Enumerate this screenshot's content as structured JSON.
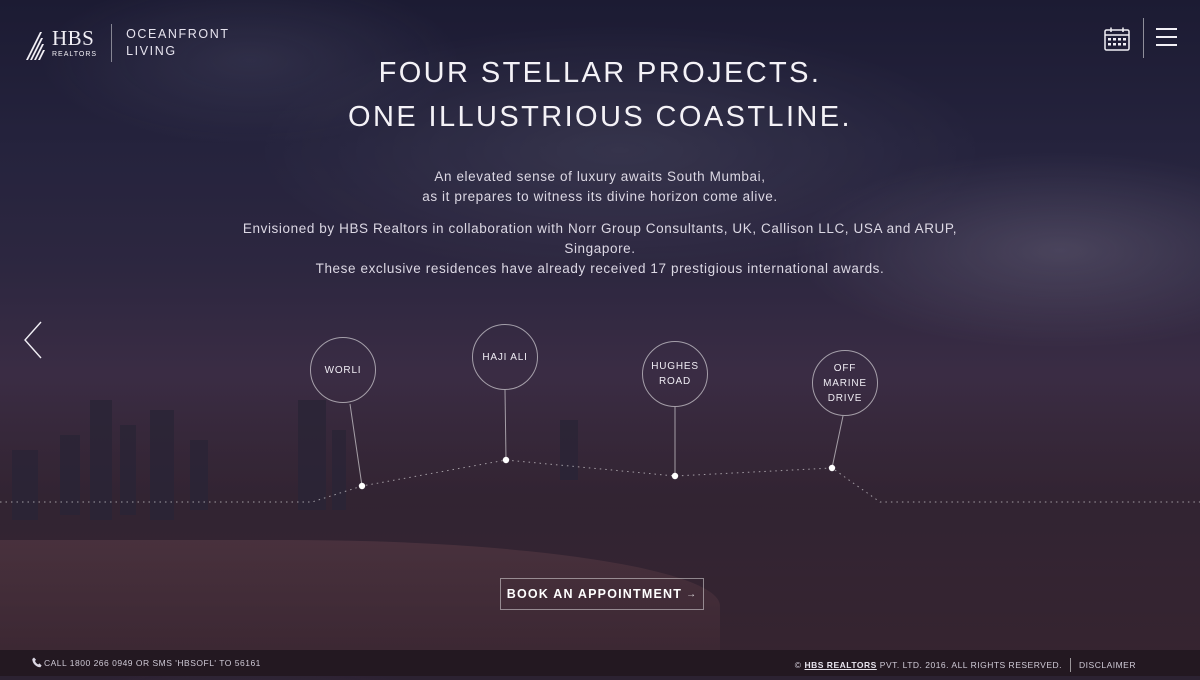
{
  "header": {
    "logo_main": "HBS",
    "logo_sub": "REALTORS",
    "tagline_line1": "OCEANFRONT",
    "tagline_line2": "LIVING",
    "calendar_icon": "calendar-icon",
    "menu_icon": "hamburger-menu-icon"
  },
  "hero": {
    "headline_line1": "FOUR STELLAR PROJECTS.",
    "headline_line2": "ONE ILLUSTRIOUS COASTLINE.",
    "intro_line1": "An elevated sense of luxury awaits South Mumbai,",
    "intro_line2": "as it prepares to witness its divine horizon come alive.",
    "detail_line1": "Envisioned by HBS Realtors in collaboration with Norr Group Consultants, UK, Callison LLC, USA and ARUP,",
    "detail_line2": "Singapore.",
    "detail_line3": "These exclusive residences have already received 17 prestigious international awards."
  },
  "locations": [
    {
      "lines": [
        "WORLI"
      ]
    },
    {
      "lines": [
        "HAJI ALI"
      ]
    },
    {
      "lines": [
        "HUGHES",
        "ROAD"
      ]
    },
    {
      "lines": [
        "OFF",
        "MARINE",
        "DRIVE"
      ]
    }
  ],
  "nav": {
    "prev_icon": "chevron-left-icon"
  },
  "cta": {
    "label": "BOOK AN APPOINTMENT",
    "arrow": "→"
  },
  "footer": {
    "phone_icon": "phone-icon",
    "contact_text": "CALL 1800 266 0949 OR SMS 'HBSOFL' TO 56161",
    "copyright_prefix": "©",
    "company": "HBS REALTORS",
    "copyright_suffix": "PVT. LTD. 2016. ALL RIGHTS RESERVED.",
    "disclaimer": "DISCLAIMER"
  },
  "colors": {
    "background_top": "#1c1b33",
    "background_bottom": "#30202d",
    "text_primary": "#f4f2f7",
    "line_color": "#ffffff"
  }
}
